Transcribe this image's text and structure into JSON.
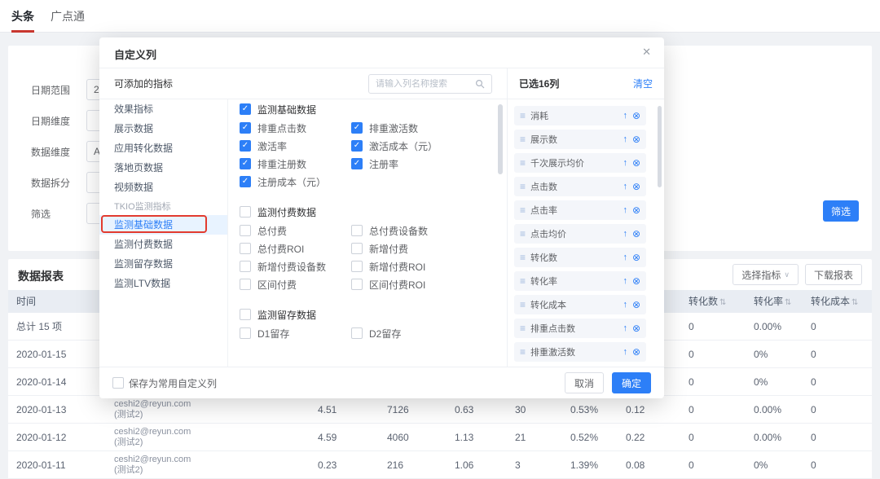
{
  "topbar": {
    "tabs": [
      {
        "label": "头条"
      },
      {
        "label": "广点通"
      }
    ]
  },
  "filters": {
    "rows": [
      {
        "label": "日期范围",
        "value": "20"
      },
      {
        "label": "日期维度",
        "value": ""
      },
      {
        "label": "数据维度",
        "value": "A"
      },
      {
        "label": "数据拆分",
        "value": ""
      },
      {
        "label": "筛选",
        "value": ""
      }
    ],
    "submit_label": "筛选"
  },
  "report": {
    "title": "数据报表",
    "metric_select_label": "选择指标",
    "download_label": "下载报表",
    "table": {
      "time_header": "时间",
      "right_headers": [
        "转化数",
        "转化率",
        "转化成本"
      ],
      "rows": [
        {
          "time": "总计 15 项",
          "account": "",
          "values": [
            "",
            "",
            "",
            "",
            "",
            "",
            "0",
            "0.00%",
            "0"
          ]
        },
        {
          "time": "2020-01-15",
          "account": "",
          "values": [
            "",
            "",
            "",
            "",
            "",
            "",
            "0",
            "0%",
            "0"
          ]
        },
        {
          "time": "2020-01-14",
          "account": "",
          "values": [
            "",
            "",
            "",
            "",
            "",
            "",
            "0",
            "0%",
            "0"
          ]
        },
        {
          "time": "2020-01-13",
          "account": "ceshi2@reyun.com(测试2)",
          "values": [
            "4.51",
            "7126",
            "0.63",
            "30",
            "0.53%",
            "0.12",
            "0",
            "0.00%",
            "0"
          ]
        },
        {
          "time": "2020-01-12",
          "account": "ceshi2@reyun.com(测试2)",
          "values": [
            "4.59",
            "4060",
            "1.13",
            "21",
            "0.52%",
            "0.22",
            "0",
            "0.00%",
            "0"
          ]
        },
        {
          "time": "2020-01-11",
          "account": "ceshi2@reyun.com(测试2)",
          "values": [
            "0.23",
            "216",
            "1.06",
            "3",
            "1.39%",
            "0.08",
            "0",
            "0%",
            "0"
          ]
        }
      ]
    }
  },
  "modal": {
    "title": "自定义列",
    "available_label": "可添加的指标",
    "search_placeholder": "请输入列名称搜索",
    "sidebar": [
      {
        "label": "效果指标",
        "type": "item"
      },
      {
        "label": "展示数据",
        "type": "item"
      },
      {
        "label": "应用转化数据",
        "type": "item"
      },
      {
        "label": "落地页数据",
        "type": "item"
      },
      {
        "label": "视频数据",
        "type": "item"
      },
      {
        "label": "TKIO监测指标",
        "type": "section"
      },
      {
        "label": "监测基础数据",
        "type": "active"
      },
      {
        "label": "监测付费数据",
        "type": "item"
      },
      {
        "label": "监测留存数据",
        "type": "item"
      },
      {
        "label": "监测LTV数据",
        "type": "item"
      }
    ],
    "groups": [
      {
        "title": "监测基础数据",
        "checked": true,
        "items": [
          {
            "label": "排重点击数",
            "checked": true
          },
          {
            "label": "排重激活数",
            "checked": true
          },
          {
            "label": "激活率",
            "checked": true
          },
          {
            "label": "激活成本（元）",
            "checked": true
          },
          {
            "label": "排重注册数",
            "checked": true
          },
          {
            "label": "注册率",
            "checked": true
          },
          {
            "label": "注册成本（元）",
            "checked": true
          }
        ]
      },
      {
        "title": "监测付费数据",
        "checked": false,
        "items": [
          {
            "label": "总付费",
            "checked": false
          },
          {
            "label": "总付费设备数",
            "checked": false
          },
          {
            "label": "总付费ROI",
            "checked": false
          },
          {
            "label": "新增付费",
            "checked": false
          },
          {
            "label": "新增付费设备数",
            "checked": false
          },
          {
            "label": "新增付费ROI",
            "checked": false
          },
          {
            "label": "区间付费",
            "checked": false
          },
          {
            "label": "区间付费ROI",
            "checked": false
          }
        ]
      },
      {
        "title": "监测留存数据",
        "checked": false,
        "items": [
          {
            "label": "D1留存",
            "checked": false
          },
          {
            "label": "D2留存",
            "checked": false
          }
        ]
      }
    ],
    "selected": {
      "title": "已选16列",
      "clear_label": "清空",
      "items": [
        "消耗",
        "展示数",
        "千次展示均价",
        "点击数",
        "点击率",
        "点击均价",
        "转化数",
        "转化率",
        "转化成本",
        "排重点击数",
        "排重激活数"
      ]
    },
    "footer": {
      "save_label": "保存为常用自定义列",
      "cancel_label": "取消",
      "confirm_label": "确定"
    }
  },
  "colors": {
    "accent": "#2D7FF7",
    "annotation_red": "#E23B2F",
    "tab_active_red": "#C8372F"
  }
}
